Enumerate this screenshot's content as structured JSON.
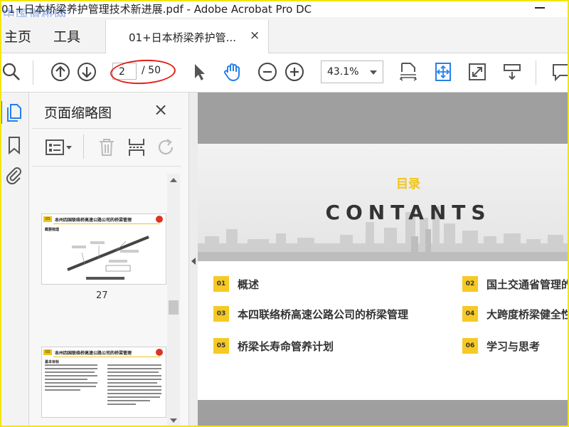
{
  "window": {
    "title": "01+日本桥梁养护管理技术新进展.pdf - Adobe Acrobat Pro DC",
    "watermark": "中国道桥网"
  },
  "tabs": {
    "home": "主页",
    "tools": "工具",
    "document_tab": "01+日本桥梁养护管...",
    "close_glyph": "×"
  },
  "toolbar": {
    "page_current": "2",
    "page_total": "/ 50",
    "zoom": "43.1%"
  },
  "thumbnail_panel": {
    "title": "页面缩略图",
    "close_glyph": "×",
    "thumbs": [
      {
        "page_label": "27",
        "header_num": "03",
        "header_text": "本州四国联络桥高速公路公司的桥梁管理",
        "sub": "概要梳理"
      },
      {
        "page_label": "",
        "header_num": "03",
        "header_text": "本州四国联络桥高速公路公司的桥梁管理",
        "sub": "基本目标"
      }
    ]
  },
  "slide": {
    "subtitle": "目录",
    "title": "CONTANTS",
    "toc": [
      {
        "num": "01",
        "text": "概述"
      },
      {
        "num": "02",
        "text": "国土交通省管理的"
      },
      {
        "num": "03",
        "text": "本四联络桥高速公路公司的桥梁管理"
      },
      {
        "num": "04",
        "text": "大跨度桥梁健全性"
      },
      {
        "num": "05",
        "text": "桥梁长寿命管养计划"
      },
      {
        "num": "06",
        "text": "学习与思考"
      }
    ]
  },
  "colors": {
    "accent_yellow": "#f6c925",
    "acrobat_blue": "#2680eb",
    "annotation_red": "#e0201a"
  }
}
